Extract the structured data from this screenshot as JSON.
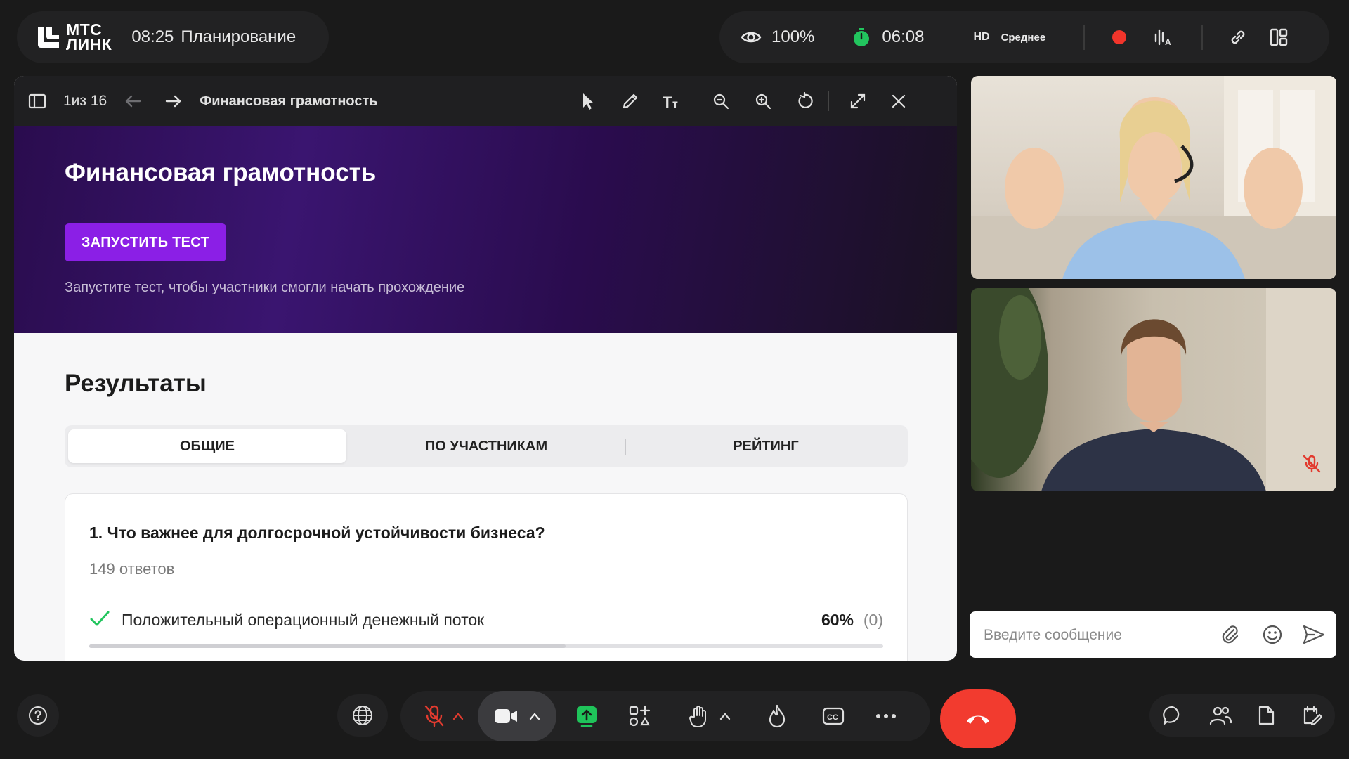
{
  "brand": {
    "logo_line1": "МТС",
    "logo_line2": "ЛИНК",
    "time": "08:25",
    "title": "Планирование"
  },
  "status": {
    "visibility": "100%",
    "timer": "06:08",
    "quality_badge": "HD",
    "quality_label": "Среднее"
  },
  "presentation": {
    "page_indicator": "1из 16",
    "title": "Финансовая грамотность",
    "hero": {
      "title": "Финансовая грамотность",
      "start_button": "ЗАПУСТИТЬ ТЕСТ",
      "hint": "Запустите тест, чтобы участники смогли начать прохождение"
    },
    "results": {
      "title": "Результаты",
      "tabs": [
        {
          "label": "ОБЩИЕ"
        },
        {
          "label": "ПО УЧАСТНИКАМ"
        },
        {
          "label": "РЕЙТИНГ"
        }
      ],
      "question": {
        "title": "1. Что важнее для долгосрочной устойчивости бизнеса?",
        "answers_count": "149 ответов",
        "answer": {
          "text": "Положительный операционный денежный поток",
          "percent": "60%",
          "count": "(0)",
          "fill_fraction": 0.6
        }
      }
    }
  },
  "chat": {
    "placeholder": "Введите сообщение"
  },
  "colors": {
    "accent_purple": "#8b1fe6",
    "hangup_red": "#f23b2f",
    "record_red": "#f2352b",
    "timer_green": "#22c55e",
    "share_green": "#1fc45a"
  },
  "icons": [
    "eye-icon",
    "timer-icon",
    "record-icon",
    "audio-levels-icon",
    "link-icon",
    "layout-icon",
    "sidebar-toggle-icon",
    "arrow-left-icon",
    "arrow-right-icon",
    "pointer-icon",
    "pencil-icon",
    "text-size-icon",
    "zoom-out-icon",
    "zoom-in-icon",
    "rotate-icon",
    "expand-icon",
    "close-icon",
    "paperclip-icon",
    "emoji-icon",
    "send-icon",
    "help-icon",
    "globe-icon",
    "mic-off-icon",
    "camera-icon",
    "share-screen-icon",
    "apps-icon",
    "hand-icon",
    "fire-icon",
    "captions-icon",
    "more-icon",
    "hangup-icon",
    "chat-icon",
    "people-icon",
    "files-icon",
    "notes-icon"
  ]
}
